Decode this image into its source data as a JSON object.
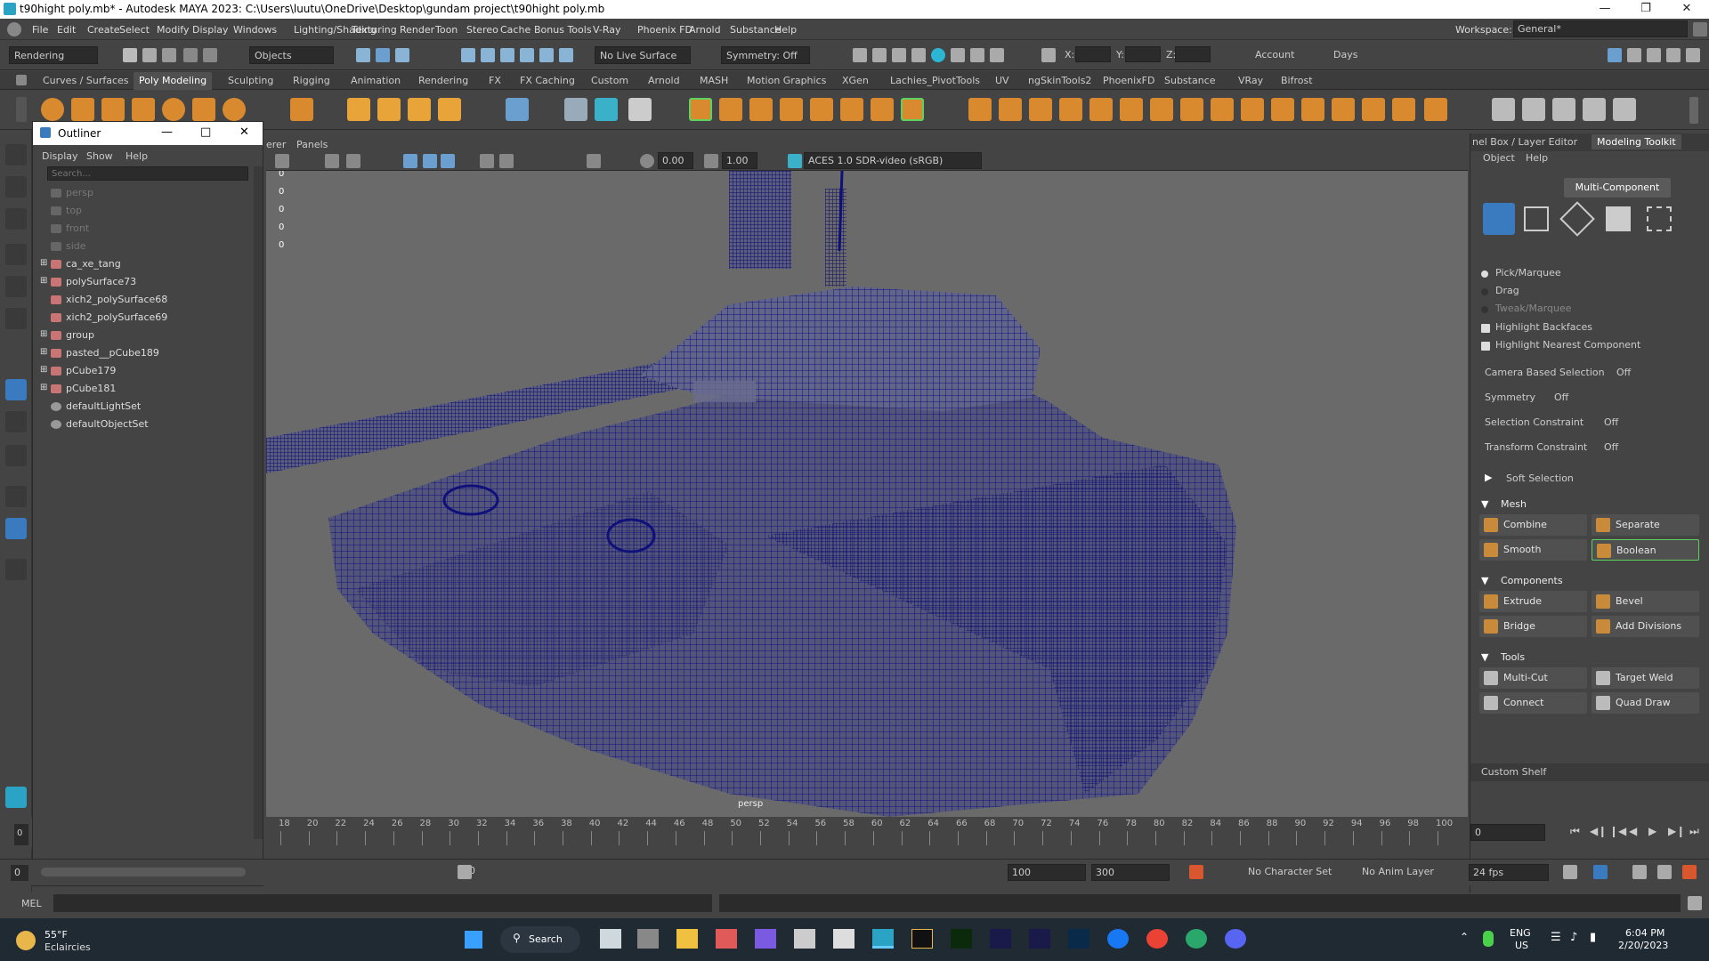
{
  "title": {
    "text": "t90hight poly.mb* - Autodesk MAYA 2023: C:\\Users\\luutu\\OneDrive\\Desktop\\gundam project\\t90hight poly.mb"
  },
  "menus": [
    "File",
    "Edit",
    "Create",
    "Select",
    "Modify",
    "Display",
    "Windows",
    "Lighting/Shading",
    "Texturing",
    "Render",
    "Toon",
    "Stereo",
    "Cache",
    "Bonus Tools",
    "V-Ray",
    "Phoenix FD",
    "Arnold",
    "Substance",
    "Help"
  ],
  "workspace": {
    "label": "Workspace:",
    "value": "General*"
  },
  "status": {
    "menuset": "Rendering",
    "objects": "Objects",
    "live_surface": "No Live Surface",
    "symmetry": "Symmetry: Off",
    "x": "X:",
    "y": "Y:",
    "z": "Z:",
    "account": "Account",
    "days": "Days"
  },
  "shelf_tabs": [
    "Curves / Surfaces",
    "Poly Modeling",
    "Sculpting",
    "Rigging",
    "Animation",
    "Rendering",
    "FX",
    "FX Caching",
    "Custom",
    "Arnold",
    "MASH",
    "Motion Graphics",
    "XGen",
    "Lachies_PivotTools",
    "UV",
    "ngSkinTools2",
    "PhoenixFD",
    "Substance",
    "VRay",
    "Bifrost"
  ],
  "outliner": {
    "title": "Outliner",
    "menu": [
      "Display",
      "Show",
      "Help"
    ],
    "search_placeholder": "Search...",
    "items": [
      {
        "label": "persp",
        "dim": true
      },
      {
        "label": "top",
        "dim": true
      },
      {
        "label": "front",
        "dim": true
      },
      {
        "label": "side",
        "dim": true
      },
      {
        "label": "ca_xe_tang",
        "dim": false
      },
      {
        "label": "polySurface73",
        "dim": false
      },
      {
        "label": "xich2_polySurface68",
        "dim": false
      },
      {
        "label": "xich2_polySurface69",
        "dim": false
      },
      {
        "label": "group",
        "dim": false
      },
      {
        "label": "pasted__pCube189",
        "dim": false
      },
      {
        "label": "pCube179",
        "dim": false
      },
      {
        "label": "pCube181",
        "dim": false
      },
      {
        "label": "defaultLightSet",
        "dim": false
      },
      {
        "label": "defaultObjectSet",
        "dim": false
      }
    ]
  },
  "viewport": {
    "menu": [
      "erer",
      "Panels"
    ],
    "exposure": "0.00",
    "gamma": "1.00",
    "color_space": "ACES 1.0 SDR-video (sRGB)",
    "hud_values": [
      "0",
      "0",
      "0",
      "0",
      "0"
    ],
    "camera_label": "persp"
  },
  "right_panel": {
    "tabs": [
      "nel Box / Layer Editor",
      "Modeling Toolkit"
    ],
    "menu": [
      "Object",
      "Help"
    ],
    "mode": "Multi-Component",
    "options": [
      "Pick/Marquee",
      "Drag",
      "Tweak/Marquee"
    ],
    "checks": [
      "Highlight Backfaces",
      "Highlight Nearest Component"
    ],
    "settings": [
      {
        "label": "Camera Based Selection",
        "value": "Off"
      },
      {
        "label": "Symmetry",
        "value": "Off"
      },
      {
        "label": "Selection Constraint",
        "value": "Off"
      },
      {
        "label": "Transform Constraint",
        "value": "Off"
      }
    ],
    "soft_selection": "Soft Selection",
    "mesh": {
      "title": "Mesh",
      "buttons": [
        "Combine",
        "Separate",
        "Smooth",
        "Boolean"
      ]
    },
    "components": {
      "title": "Components",
      "buttons": [
        "Extrude",
        "Bevel",
        "Bridge",
        "Add Divisions"
      ]
    },
    "tools": {
      "title": "Tools",
      "buttons": [
        "Multi-Cut",
        "Target Weld",
        "Connect",
        "Quad Draw"
      ]
    },
    "custom_shelf": "Custom Shelf"
  },
  "timeline": {
    "ticks": [
      "18",
      "20",
      "22",
      "24",
      "26",
      "28",
      "30",
      "32",
      "34",
      "36",
      "38",
      "40",
      "42",
      "44",
      "46",
      "48",
      "50",
      "52",
      "54",
      "56",
      "58",
      "60",
      "62",
      "64",
      "66",
      "68",
      "70",
      "72",
      "74",
      "76",
      "78",
      "80",
      "82",
      "84",
      "86",
      "88",
      "90",
      "92",
      "94",
      "96",
      "98",
      "100"
    ],
    "current": "0"
  },
  "range": {
    "start": "0",
    "slider_value": "100",
    "end": "100",
    "anim_end": "300",
    "character_set": "No Character Set",
    "anim_layer": "No Anim Layer",
    "fps": "24 fps"
  },
  "mel": {
    "label": "MEL"
  },
  "taskbar": {
    "weather_temp": "55°F",
    "weather_desc": "Eclaircies",
    "search": "Search",
    "lang": "ENG",
    "region": "US",
    "time": "6:04 PM",
    "date": "2/20/2023"
  }
}
